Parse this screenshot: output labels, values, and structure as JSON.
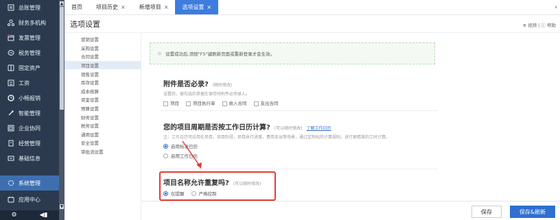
{
  "sidebar": {
    "items": [
      {
        "label": "总账管理",
        "icon": "ledger-icon"
      },
      {
        "label": "财务多机构",
        "icon": "org-icon"
      },
      {
        "label": "发票管理",
        "icon": "invoice-icon"
      },
      {
        "label": "税务管理",
        "icon": "tax-icon"
      },
      {
        "label": "固定资产",
        "icon": "asset-icon"
      },
      {
        "label": "工资",
        "icon": "salary-icon"
      },
      {
        "label": "小畅报销",
        "icon": "reimburse-icon"
      },
      {
        "label": "智能管理",
        "icon": "smart-icon"
      },
      {
        "label": "企业协同",
        "icon": "collab-icon"
      },
      {
        "label": "经营管理",
        "icon": "operation-icon"
      },
      {
        "label": "基础信息",
        "icon": "basic-info-icon"
      },
      {
        "label": "系统管理",
        "icon": "system-icon"
      },
      {
        "label": "应用中心",
        "icon": "app-center-icon"
      }
    ],
    "active_label": "系统管理"
  },
  "tabs": [
    {
      "label": "首页",
      "closable": false
    },
    {
      "label": "项目历史",
      "closable": true
    },
    {
      "label": "新增项目",
      "closable": true
    },
    {
      "label": "选项设置",
      "closable": true,
      "active": true
    }
  ],
  "page": {
    "title": "选项设置",
    "header_right": "⊕ 视频 | ⓘ 帮助"
  },
  "settings_menu": {
    "items": [
      "营销设置",
      "采购设置",
      "合同设置",
      "项目设置",
      "销售设置",
      "库存设置",
      "成本核算",
      "资金设置",
      "预算设置",
      "财务设置",
      "税务设置",
      "通用设置",
      "安全设置",
      "审批流设置"
    ],
    "active": "项目设置"
  },
  "notice": {
    "text": "设置成功后,须按\"F5\"键刷新页面或重新登录才会生效。"
  },
  "attachment": {
    "title": "附件是否必录?",
    "hint": "(随时修改)",
    "desc": "设置后，被勾选的单据在保存时附件必须录入。",
    "options": [
      "项目",
      "项目执行单",
      "收入合同",
      "支出合同"
    ]
  },
  "workcalendar": {
    "title": "您的项目周期是否按工作日历计算?",
    "hint": "(可以随时修改)",
    "link": "了解工作日历",
    "desc": "注：工作日历可应用在项目，项目阶段，项目执行进度，费用支出等场景，通过定制化的计算规则，进行更精准的工时计算。",
    "options": [
      "启用标准日历",
      "启用工作日历"
    ],
    "selected": "启用标准日历"
  },
  "duplicate_name": {
    "title": "项目名称允许重复吗?",
    "hint": "(可以随时修改)",
    "options": [
      "仅提醒",
      "严格控制"
    ],
    "selected": "仅提醒"
  },
  "footer": {
    "save_label": "保存",
    "save_refresh_label": "保存&刷新"
  },
  "colors": {
    "nav_bg": "#2b3a4f",
    "accent": "#2f6fd0",
    "highlight_box": "#e43a33"
  }
}
